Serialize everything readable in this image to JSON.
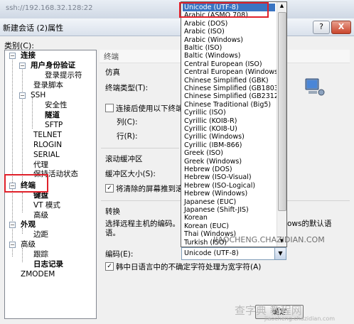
{
  "window": {
    "address": "ssh://192.168.32.128:22",
    "title": "新建会话 (2)属性",
    "help_btn": "?",
    "close_btn": "X"
  },
  "tree": {
    "label": "类别(C):",
    "items": [
      {
        "text": "连接"
      },
      {
        "text": "用户身份验证"
      },
      {
        "text": "登录提示符"
      },
      {
        "text": "登录脚本"
      },
      {
        "text": "SSH"
      },
      {
        "text": "安全性"
      },
      {
        "text": "隧道"
      },
      {
        "text": "SFTP"
      },
      {
        "text": "TELNET"
      },
      {
        "text": "RLOGIN"
      },
      {
        "text": "SERIAL"
      },
      {
        "text": "代理"
      },
      {
        "text": "保持活动状态"
      },
      {
        "text": "终端"
      },
      {
        "text": "键盘"
      },
      {
        "text": "VT 模式"
      },
      {
        "text": "高级"
      },
      {
        "text": "外观"
      },
      {
        "text": "边距"
      },
      {
        "text": "高级"
      },
      {
        "text": "跟踪"
      },
      {
        "text": "日志记录"
      },
      {
        "text": "ZMODEM"
      }
    ]
  },
  "panel": {
    "header": "终端",
    "emulation_section": "仿真",
    "terminal_type_label": "终端类型(T):",
    "use_after_login_label": "连接后使用以下终端",
    "col_label": "列(C):",
    "row_label": "行(R):",
    "scroll_section": "滚动缓冲区",
    "buffer_size_label": "缓冲区大小(S):",
    "clear_screen_label": "将清除的屏幕推到滚",
    "convert_section": "转换",
    "convert_desc_1": "选择远程主机的编码。",
    "convert_desc_2": "语。",
    "convert_desc_right": "ows的默认语",
    "encoding_label": "编码(E):",
    "encoding_value": "Unicode (UTF-8)",
    "cjk_label": "韩中日语言中的不确定字符处理为宽字符(A)",
    "ok_button": "确定"
  },
  "dropdown_options": [
    "Unicode (UTF-8)",
    "Arabic (ASMO 708)",
    "Arabic (DOS)",
    "Arabic (ISO)",
    "Arabic (Windows)",
    "Baltic (ISO)",
    "Baltic (Windows)",
    "Central European (ISO)",
    "Central European (Windows)",
    "Chinese Simplified (GBK)",
    "Chinese Simplified (GB18030)",
    "Chinese Simplified (GB2312)",
    "Chinese Traditional (Big5)",
    "Cyrillic (ISO)",
    "Cyrillic (KOI8-R)",
    "Cyrillic (KOI8-U)",
    "Cyrillic (Windows)",
    "Cyrillic (IBM-866)",
    "Greek (ISO)",
    "Greek (Windows)",
    "Hebrew (DOS)",
    "Hebrew (ISO-Visual)",
    "Hebrew (ISO-Logical)",
    "Hebrew (Windows)",
    "Japanese (EUC)",
    "Japanese (Shift-JIS)",
    "Korean",
    "Korean (EUC)",
    "Thai (Windows)",
    "Turkish (ISO)"
  ],
  "watermark": {
    "main": "查字典 教程网",
    "url": "jiaocheng.chazidian.com",
    "overlay": "JIAOCHENG.CHAZIDIAN.COM"
  },
  "colors": {
    "selection": "#3a74c2",
    "highlight_box": "#e0212a"
  }
}
